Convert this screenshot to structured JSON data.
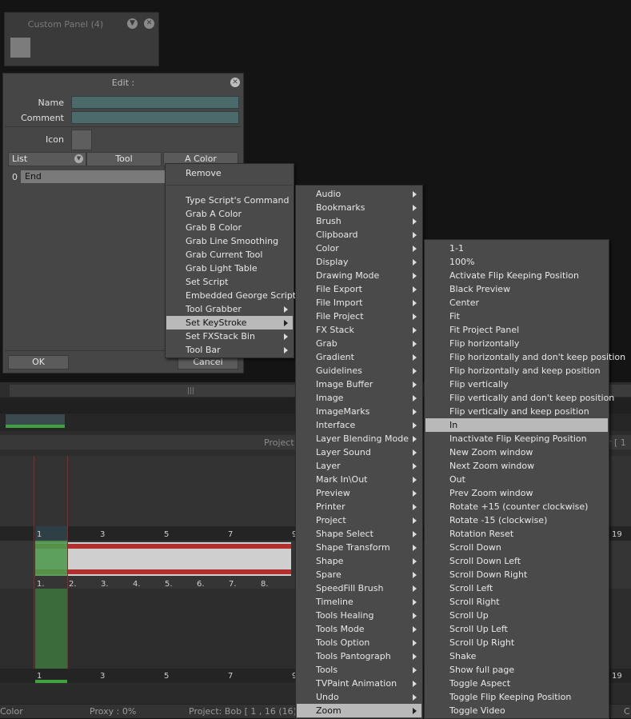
{
  "custom_panel": {
    "title": "Custom Panel (4)",
    "collapse_glyph": "▼",
    "close_glyph": "✕"
  },
  "edit_dialog": {
    "title": "Edit :",
    "close_glyph": "✕",
    "name_label": "Name",
    "name_value": "",
    "comment_label": "Comment",
    "comment_value": "",
    "icon_label": "Icon",
    "list_label": "List",
    "tool_label": "Tool",
    "acolor_label": "A Color",
    "row_index": "0",
    "row_value": "End",
    "ok_label": "OK",
    "cancel_label": "Cancel"
  },
  "context_menu": {
    "items": [
      {
        "label": "Remove",
        "submenu": false
      },
      {
        "label": "Type Script's Command",
        "submenu": false
      },
      {
        "label": "Grab A Color",
        "submenu": false
      },
      {
        "label": "Grab B Color",
        "submenu": false
      },
      {
        "label": "Grab Line Smoothing",
        "submenu": false
      },
      {
        "label": "Grab Current Tool",
        "submenu": false
      },
      {
        "label": "Grab Light Table",
        "submenu": false
      },
      {
        "label": "Set Script",
        "submenu": false
      },
      {
        "label": "Embedded George Script",
        "submenu": false
      },
      {
        "label": "Tool Grabber",
        "submenu": true
      },
      {
        "label": "Set KeyStroke",
        "submenu": true,
        "highlighted": true
      },
      {
        "label": "Set FXStack Bin",
        "submenu": true
      },
      {
        "label": "Tool Bar",
        "submenu": true
      }
    ]
  },
  "category_menu": {
    "items": [
      "Audio",
      "Bookmarks",
      "Brush",
      "Clipboard",
      "Color",
      "Display",
      "Drawing Mode",
      "File Export",
      "File Import",
      "File Project",
      "FX Stack",
      "Grab",
      "Gradient",
      "Guidelines",
      "Image Buffer",
      "Image",
      "ImageMarks",
      "Interface",
      "Layer Blending Mode",
      "Layer Sound",
      "Layer",
      "Mark In\\Out",
      "Preview",
      "Printer",
      "Project",
      "Shape Select",
      "Shape Transform",
      "Shape",
      "Spare",
      "SpeedFill Brush",
      "Timeline",
      "Tools Healing",
      "Tools Mode",
      "Tools Option",
      "Tools Pantograph",
      "Tools",
      "TVPaint Animation",
      "Undo",
      "Zoom"
    ],
    "highlighted": "Zoom"
  },
  "zoom_menu": {
    "items": [
      "1-1",
      "100%",
      "Activate Flip Keeping Position",
      "Black Preview",
      "Center",
      "Fit",
      "Fit Project Panel",
      "Flip horizontally",
      "Flip horizontally and don't keep position",
      "Flip horizontally and keep position",
      "Flip vertically",
      "Flip vertically and don't keep position",
      "Flip vertically and keep position",
      "In",
      "Inactivate Flip Keeping Position",
      "New Zoom window",
      "Next Zoom window",
      "Out",
      "Prev Zoom window",
      "Rotate +15 (counter clockwise)",
      "Rotate -15 (clockwise)",
      "Rotation Reset",
      "Scroll Down",
      "Scroll Down Left",
      "Scroll Down Right",
      "Scroll Left",
      "Scroll Right",
      "Scroll Up",
      "Scroll Up Left",
      "Scroll Up Right",
      "Shake",
      "Show full page",
      "Toggle Aspect",
      "Toggle Flip Keeping Position",
      "Toggle Video"
    ],
    "highlighted": "In"
  },
  "timeline": {
    "project_label": "Project:",
    "right_fragment": "r [ 1",
    "ruler_top": [
      "1",
      "3",
      "5",
      "7"
    ],
    "ruler_bottom": [
      "1",
      "3",
      "5",
      "7"
    ],
    "frame_numbers": [
      "1.",
      "2.",
      "3.",
      "4.",
      "5.",
      "6.",
      "7.",
      "8."
    ],
    "right_tick_top": "19",
    "right_tick_bottom": "19",
    "nine_a": "9",
    "nine_b": "9"
  },
  "statusbar": {
    "color": "Color",
    "proxy": "Proxy : 0%",
    "project": "Project: Bob [ 1 , 16  (16) ]",
    "right": "C"
  },
  "colors": {
    "menu_bg": "#4a4a4a",
    "highlight": "#b9b9b9",
    "field": "#4d6a6a",
    "green": "#3ea33e",
    "red": "#b03030"
  }
}
